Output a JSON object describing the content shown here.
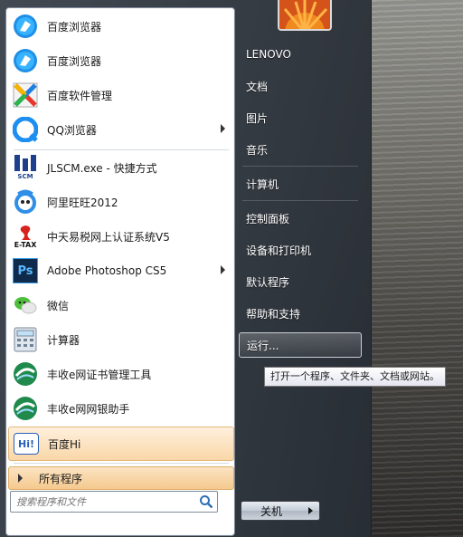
{
  "apps": [
    {
      "label": "百度浏览器",
      "icon": "baidu-browser-icon"
    },
    {
      "label": "百度浏览器",
      "icon": "baidu-browser-icon"
    },
    {
      "label": "百度软件管理",
      "icon": "baidu-software-manager-icon"
    },
    {
      "label": "QQ浏览器",
      "icon": "qq-browser-icon"
    },
    {
      "label": "JLSCM.exe - 快捷方式",
      "icon": "jlscm-icon"
    },
    {
      "label": "阿里旺旺2012",
      "icon": "aliwangwang-icon"
    },
    {
      "label": "中天易税网上认证系统V5",
      "icon": "etax-icon"
    },
    {
      "label": "Adobe Photoshop CS5",
      "icon": "photoshop-icon"
    },
    {
      "label": "微信",
      "icon": "wechat-icon"
    },
    {
      "label": "计算器",
      "icon": "calculator-icon"
    },
    {
      "label": "丰收e网证书管理工具",
      "icon": "fengshou-icon"
    },
    {
      "label": "丰收e网网银助手",
      "icon": "fengshou-icon"
    },
    {
      "label": "百度Hi",
      "icon": "baidu-hi-icon"
    }
  ],
  "app_icon_text": {
    "jlscm": "SCM",
    "etax": "E-TAX",
    "photoshop": "Ps",
    "baidu_hi": "Hi!"
  },
  "all_programs": "所有程序",
  "search": {
    "placeholder": "搜索程序和文件"
  },
  "right_items": [
    {
      "label": "LENOVO"
    },
    {
      "label": "文档"
    },
    {
      "label": "图片"
    },
    {
      "label": "音乐"
    },
    {
      "label": "计算机"
    },
    {
      "label": "控制面板"
    },
    {
      "label": "设备和打印机"
    },
    {
      "label": "默认程序"
    },
    {
      "label": "帮助和支持"
    },
    {
      "label": "运行..."
    }
  ],
  "tooltip": "打开一个程序、文件夹、文档或网站。",
  "shutdown_label": "关机",
  "colors": {
    "highlight": "#f9d7a8",
    "menu_bg": "#3c444e",
    "left_pane_bg": "#ffffff"
  }
}
